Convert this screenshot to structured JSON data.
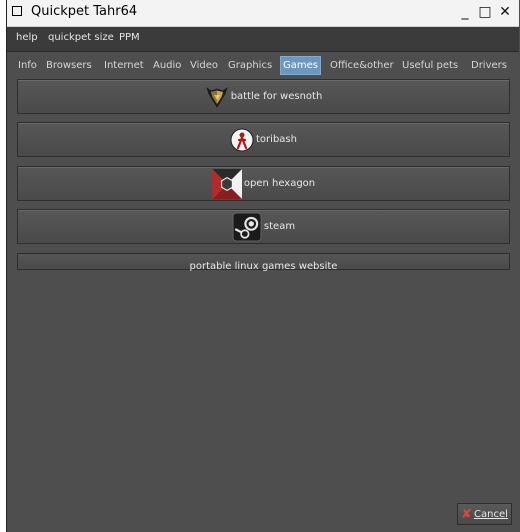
{
  "window": {
    "title": "Quickpet Tahr64",
    "minimize_glyph": "_",
    "maximize_glyph": "□",
    "close_glyph": "✕"
  },
  "menu": {
    "items": [
      "help",
      "quickpet size",
      "PPM"
    ]
  },
  "tabs": {
    "items": [
      "Info",
      "Browsers",
      "Internet",
      "Audio",
      "Video",
      "Graphics",
      "Games",
      "Office&other",
      "Useful pets",
      "Drivers"
    ],
    "active": "Games",
    "active_color": "#6f97bd"
  },
  "games": {
    "buttons": [
      {
        "label": "battle for wesnoth",
        "icon": "wesnoth-shield-icon"
      },
      {
        "label": "toribash",
        "icon": "toribash-icon"
      },
      {
        "label": "open hexagon",
        "icon": "open-hexagon-icon"
      },
      {
        "label": "steam",
        "icon": "steam-icon"
      }
    ],
    "website_label": "portable linux games website"
  },
  "footer": {
    "cancel_label": "Cancel",
    "cancel_icon": "cancel-x-icon",
    "cancel_icon_color": "#e0473a"
  }
}
